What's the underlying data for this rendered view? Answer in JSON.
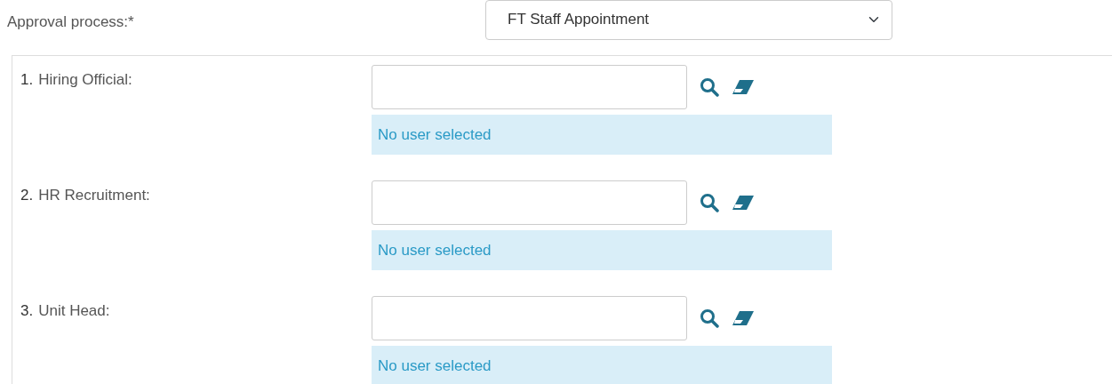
{
  "approval_process": {
    "label": "Approval process:*",
    "value": "FT Staff Appointment"
  },
  "steps": [
    {
      "number": "1.",
      "label": "Hiring Official:",
      "status": "No user selected"
    },
    {
      "number": "2.",
      "label": "HR Recruitment:",
      "status": "No user selected"
    },
    {
      "number": "3.",
      "label": "Unit Head:",
      "status": "No user selected"
    }
  ]
}
